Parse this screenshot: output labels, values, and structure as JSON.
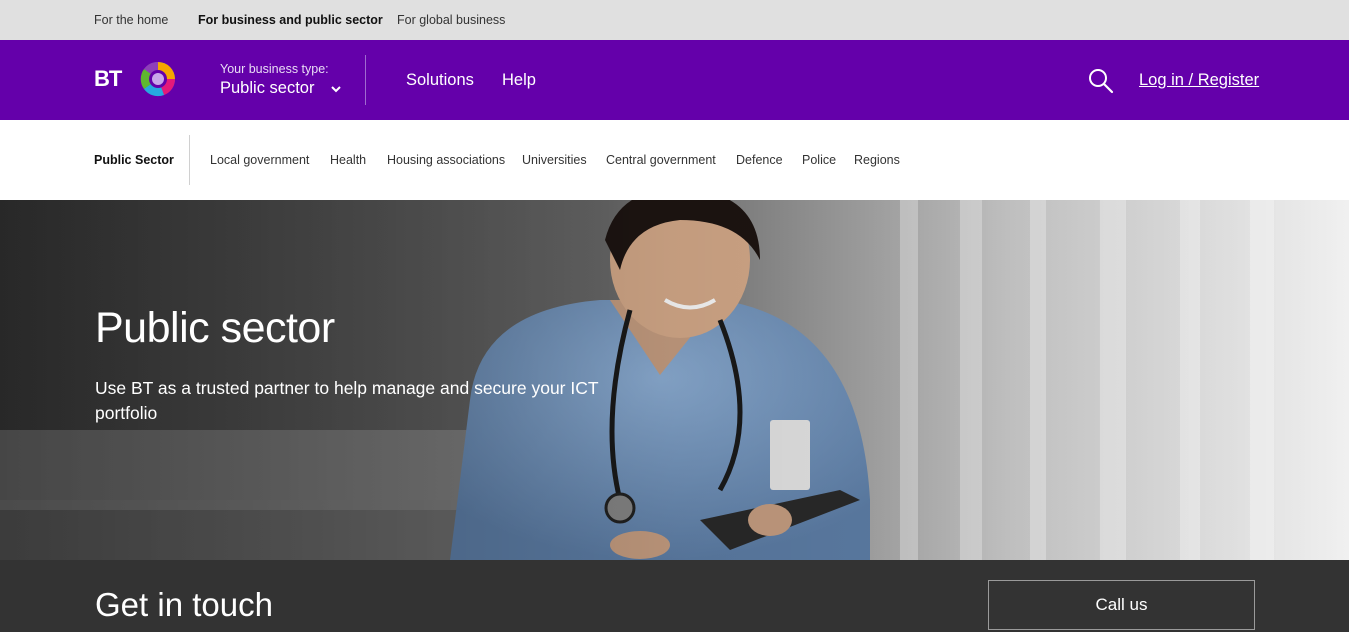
{
  "topbar": {
    "links": [
      "For the home",
      "For business and public sector",
      "For global business"
    ],
    "active_index": 1
  },
  "header": {
    "logo_text": "BT",
    "business_type_label": "Your business type:",
    "business_type_value": "Public sector",
    "nav": [
      "Solutions",
      "Help"
    ],
    "login": "Log in / Register",
    "brand_color": "#6400aa"
  },
  "subnav": {
    "section": "Public Sector",
    "items": [
      "Local government",
      "Health",
      "Housing associations",
      "Universities",
      "Central government",
      "Defence",
      "Police",
      "Regions"
    ]
  },
  "hero": {
    "title": "Public sector",
    "subtitle": "Use BT as a trusted partner to help manage and secure your ICT portfolio"
  },
  "contact": {
    "title": "Get in touch",
    "call_label": "Call us"
  },
  "icons": {
    "search": "search-icon",
    "chevron": "chevron-down-icon",
    "logo": "bt-logo"
  }
}
